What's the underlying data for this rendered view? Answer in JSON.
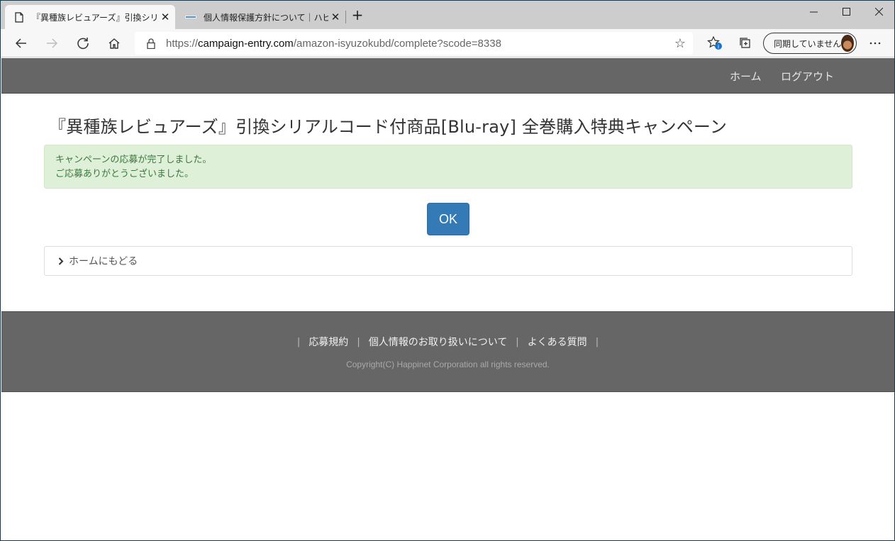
{
  "browser": {
    "tabs": [
      {
        "title": "『異種族レビュアーズ』引換シリアルコード付商品",
        "active": true
      },
      {
        "title": "個人情報保護方針について｜ハピネット",
        "active": false
      }
    ],
    "address": {
      "scheme": "https://",
      "host": "campaign-entry.com",
      "path": "/amazon-isyuzokubd/complete?scode=8338"
    },
    "profile_label": "同期していません"
  },
  "header": {
    "nav": [
      {
        "label": "ホーム"
      },
      {
        "label": "ログアウト"
      }
    ]
  },
  "main": {
    "title": "『異種族レビュアーズ』引換シリアルコード付商品[Blu-ray] 全巻購入特典キャンペーン",
    "alert_lines": [
      "キャンペーンの応募が完了しました。",
      "ご応募ありがとうございました。"
    ],
    "ok_label": "OK",
    "home_link": "ホームにもどる"
  },
  "footer": {
    "links": [
      {
        "label": "応募規約"
      },
      {
        "label": "個人情報のお取り扱いについて"
      },
      {
        "label": "よくある質問"
      }
    ],
    "separator": "|",
    "copyright": "Copyright(C) Happinet Corporation all rights reserved."
  },
  "colors": {
    "navbar_bg": "#666666",
    "alert_bg": "#dff0d8",
    "alert_text": "#3c763d",
    "primary_button": "#337ab7"
  }
}
